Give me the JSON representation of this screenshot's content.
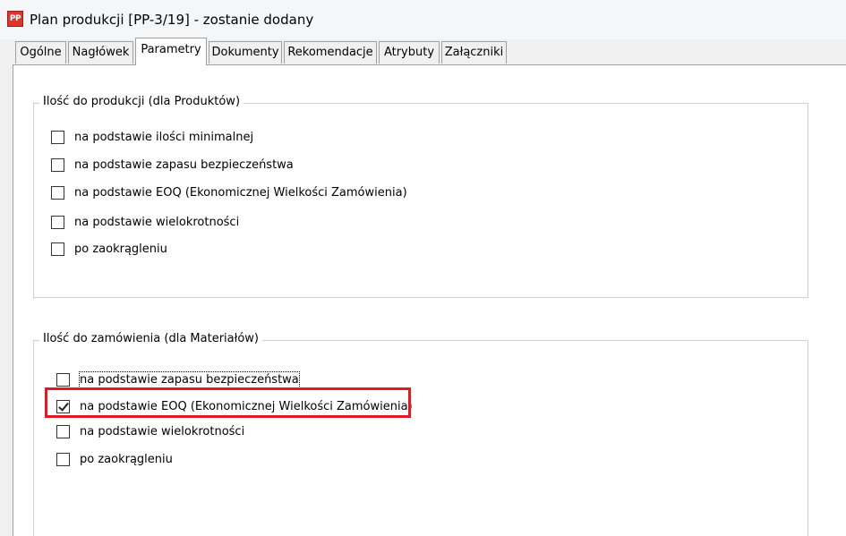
{
  "window": {
    "title": "Plan produkcji [PP-3/19] - zostanie dodany",
    "app_icon": "PP"
  },
  "tabs": [
    {
      "label": "Ogólne"
    },
    {
      "label": "Nagłówek"
    },
    {
      "label": "Parametry",
      "active": true
    },
    {
      "label": "Dokumenty"
    },
    {
      "label": "Rekomendacje"
    },
    {
      "label": "Atrybuty"
    },
    {
      "label": "Załączniki"
    }
  ],
  "production_group": {
    "legend": "Ilość do produkcji (dla Produktów)",
    "options": [
      {
        "label": "na podstawie ilości minimalnej",
        "checked": false
      },
      {
        "label": "na podstawie zapasu bezpieczeństwa",
        "checked": false
      },
      {
        "label": "na podstawie EOQ (Ekonomicznej Wielkości Zamówienia)",
        "checked": false
      },
      {
        "label": "na podstawie wielokrotności",
        "checked": false
      },
      {
        "label": "po zaokrągleniu",
        "checked": false
      }
    ]
  },
  "order_group": {
    "legend": "Ilość do zamówienia (dla Materiałów)",
    "options": [
      {
        "label": "na podstawie zapasu bezpieczeństwa",
        "checked": false
      },
      {
        "label": "na podstawie EOQ (Ekonomicznej Wielkości Zamówienia)",
        "checked": true
      },
      {
        "label": "na podstawie wielokrotności",
        "checked": false
      },
      {
        "label": "po zaokrągleniu",
        "checked": false
      }
    ]
  },
  "colors": {
    "highlight": "#e01b24",
    "app_icon": "#d9362e"
  }
}
